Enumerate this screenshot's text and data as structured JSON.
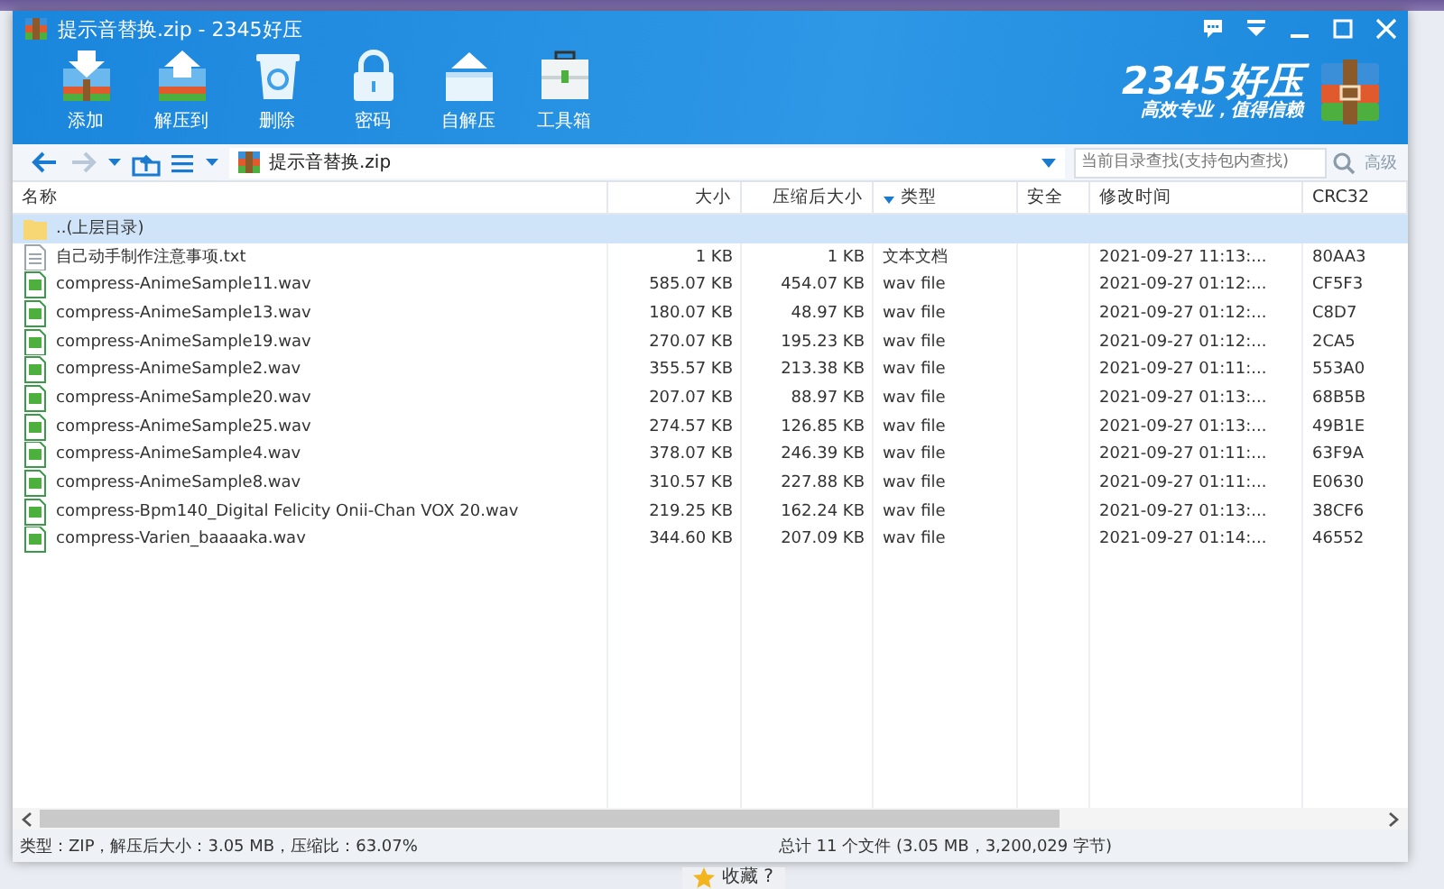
{
  "window": {
    "title": "提示音替换.zip - 2345好压"
  },
  "toolbar": {
    "buttons": [
      {
        "label": "添加",
        "kind": "add"
      },
      {
        "label": "解压到",
        "kind": "extract"
      },
      {
        "label": "删除",
        "kind": "delete"
      },
      {
        "label": "密码",
        "kind": "lock"
      },
      {
        "label": "自解压",
        "kind": "sfx"
      },
      {
        "label": "工具箱",
        "kind": "tools"
      }
    ]
  },
  "brand": {
    "name": "2345好压",
    "slogan": "高效专业，值得信赖"
  },
  "address": {
    "path": "提示音替换.zip"
  },
  "search": {
    "placeholder": "当前目录查找(支持包内查找)",
    "advanced": "高级"
  },
  "table": {
    "columns": [
      {
        "label": "名称",
        "sorted": false
      },
      {
        "label": "大小",
        "sorted": false
      },
      {
        "label": "压缩后大小",
        "sorted": false
      },
      {
        "label": "类型",
        "sorted": true
      },
      {
        "label": "安全",
        "sorted": false
      },
      {
        "label": "修改时间",
        "sorted": false
      },
      {
        "label": "CRC32",
        "sorted": false
      }
    ],
    "rows": [
      {
        "kind": "folder",
        "name": "..(上层目录)",
        "selected": true
      },
      {
        "kind": "text",
        "name": "自己动手制作注意事项.txt",
        "size": "1 KB",
        "packed": "1 KB",
        "type": "文本文档",
        "modified": "2021-09-27 11:13:...",
        "crc": "80AA3",
        "selected": false
      },
      {
        "kind": "audio",
        "name": "compress-AnimeSample11.wav",
        "size": "585.07 KB",
        "packed": "454.07 KB",
        "type": "wav file",
        "modified": "2021-09-27 01:12:...",
        "crc": "CF5F3",
        "selected": false
      },
      {
        "kind": "audio",
        "name": "compress-AnimeSample13.wav",
        "size": "180.07 KB",
        "packed": "48.97 KB",
        "type": "wav file",
        "modified": "2021-09-27 01:12:...",
        "crc": "C8D7",
        "selected": false
      },
      {
        "kind": "audio",
        "name": "compress-AnimeSample19.wav",
        "size": "270.07 KB",
        "packed": "195.23 KB",
        "type": "wav file",
        "modified": "2021-09-27 01:12:...",
        "crc": "2CA5",
        "selected": false
      },
      {
        "kind": "audio",
        "name": "compress-AnimeSample2.wav",
        "size": "355.57 KB",
        "packed": "213.38 KB",
        "type": "wav file",
        "modified": "2021-09-27 01:11:...",
        "crc": "553A0",
        "selected": false
      },
      {
        "kind": "audio",
        "name": "compress-AnimeSample20.wav",
        "size": "207.07 KB",
        "packed": "88.97 KB",
        "type": "wav file",
        "modified": "2021-09-27 01:13:...",
        "crc": "68B5B",
        "selected": false
      },
      {
        "kind": "audio",
        "name": "compress-AnimeSample25.wav",
        "size": "274.57 KB",
        "packed": "126.85 KB",
        "type": "wav file",
        "modified": "2021-09-27 01:13:...",
        "crc": "49B1E",
        "selected": false
      },
      {
        "kind": "audio",
        "name": "compress-AnimeSample4.wav",
        "size": "378.07 KB",
        "packed": "246.39 KB",
        "type": "wav file",
        "modified": "2021-09-27 01:11:...",
        "crc": "63F9A",
        "selected": false
      },
      {
        "kind": "audio",
        "name": "compress-AnimeSample8.wav",
        "size": "310.57 KB",
        "packed": "227.88 KB",
        "type": "wav file",
        "modified": "2021-09-27 01:11:...",
        "crc": "E0630",
        "selected": false
      },
      {
        "kind": "audio",
        "name": "compress-Bpm140_Digital Felicity Onii-Chan VOX 20.wav",
        "size": "219.25 KB",
        "packed": "162.24 KB",
        "type": "wav file",
        "modified": "2021-09-27 01:13:...",
        "crc": "38CF6",
        "selected": false
      },
      {
        "kind": "audio",
        "name": "compress-Varien_baaaaka.wav",
        "size": "344.60 KB",
        "packed": "207.09 KB",
        "type": "wav file",
        "modified": "2021-09-27 01:14:...",
        "crc": "46552",
        "selected": false
      }
    ]
  },
  "status_bar": {
    "left": "类型：ZIP，解压后大小：3.05 MB，压缩比：63.07%",
    "right": "总计 11 个文件 (3.05 MB，3,200,029 字节)"
  },
  "background": {
    "bottom_text": "收藏 ?"
  }
}
